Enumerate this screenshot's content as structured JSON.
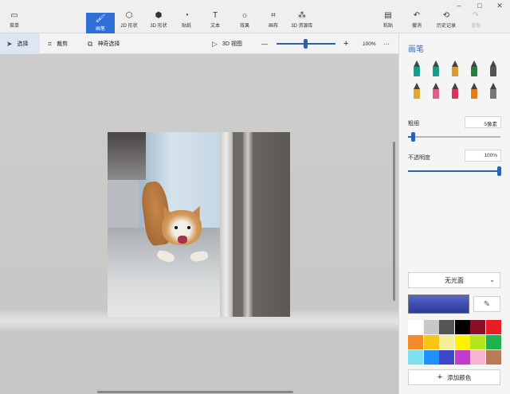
{
  "ribbon": {
    "menu_label": "菜单",
    "tools": [
      {
        "label": "画笔",
        "icon": "brush-icon",
        "glyph": "🖌"
      },
      {
        "label": "2D 形状",
        "icon": "shapes-2d-icon",
        "glyph": "⬡"
      },
      {
        "label": "3D 形状",
        "icon": "cube-icon",
        "glyph": "⬢"
      },
      {
        "label": "贴纸",
        "icon": "sticker-icon",
        "glyph": "◔"
      },
      {
        "label": "文本",
        "icon": "text-icon",
        "glyph": "T"
      },
      {
        "label": "效果",
        "icon": "effects-icon",
        "glyph": "☼"
      },
      {
        "label": "画布",
        "icon": "canvas-icon",
        "glyph": "⌗"
      },
      {
        "label": "3D 资源库",
        "icon": "library-3d-icon",
        "glyph": "⁂"
      }
    ],
    "paste_label": "粘贴",
    "undo_label": "撤消",
    "history_label": "历史记录",
    "redo_label": "重做"
  },
  "toolbar": {
    "select_label": "选择",
    "crop_label": "裁剪",
    "magic_select_label": "神奇选择",
    "view3d_label": "3D 视图",
    "zoom_minus": "—",
    "zoom_plus": "+",
    "zoom_value": "100%",
    "more": "···",
    "zoom_level_fraction": 0.46
  },
  "panel": {
    "title": "画笔",
    "thickness_label": "粗细",
    "thickness_value": "5像素",
    "thickness_fraction": 0.05,
    "opacity_label": "不透明度",
    "opacity_value": "100%",
    "opacity_fraction": 1.0,
    "finish_value": "无光面",
    "add_color_label": "添加颜色",
    "current_color": "#3f4fb0",
    "brushes": [
      {
        "name": "marker-brush-icon",
        "color": "#1a9e8c"
      },
      {
        "name": "calligraphy-pen-icon",
        "color": "#1a9e8c"
      },
      {
        "name": "oil-brush-icon",
        "color": "#d99a3a"
      },
      {
        "name": "watercolor-brush-icon",
        "color": "#2b7a3e"
      },
      {
        "name": "pixel-pen-icon",
        "color": "#555555"
      },
      {
        "name": "pencil-icon",
        "color": "#e0a833"
      },
      {
        "name": "eraser-icon",
        "color": "#e05a8a"
      },
      {
        "name": "crayon-icon",
        "color": "#d8325e"
      },
      {
        "name": "spray-can-icon",
        "color": "#e87a1c"
      },
      {
        "name": "fill-bucket-icon",
        "color": "#777777"
      }
    ],
    "palette": [
      "#ffffff",
      "#c8c8c8",
      "#555555",
      "#000000",
      "#8a1028",
      "#e81e24",
      "#f28a2a",
      "#f5c518",
      "#f4ed9a",
      "#fff200",
      "#b5e61d",
      "#22b14c",
      "#7ee0f0",
      "#1e90ff",
      "#3f48cc",
      "#c33bd1",
      "#f6b4d1",
      "#b97a57"
    ]
  }
}
